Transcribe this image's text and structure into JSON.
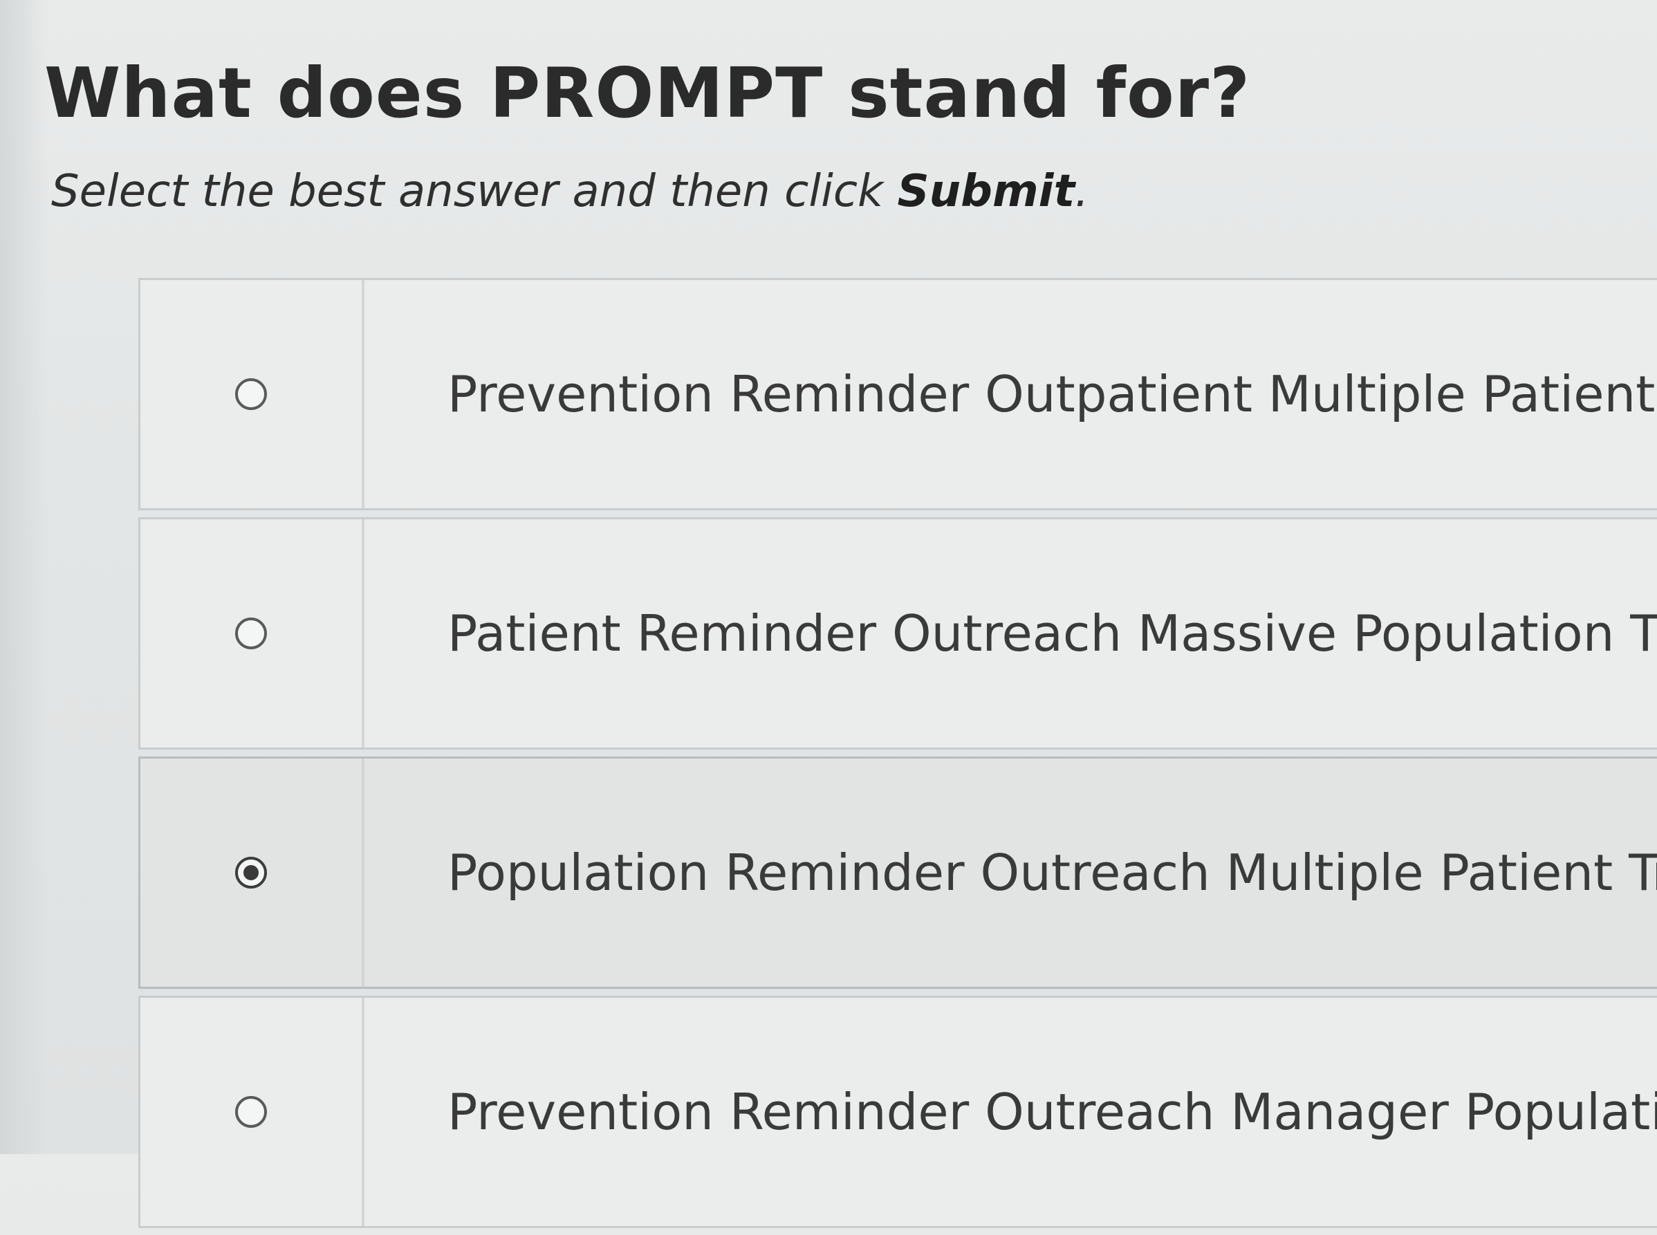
{
  "question": {
    "title": "What does PROMPT stand for?",
    "instruction_prefix": "Select the best answer and then click ",
    "instruction_bold": "Submit",
    "instruction_suffix": "."
  },
  "options": [
    {
      "label": "Prevention Reminder Outpatient Multiple Patient",
      "selected": false
    },
    {
      "label": "Patient Reminder Outreach Massive Population Tr",
      "selected": false
    },
    {
      "label": "Population Reminder Outreach Multiple Patient Tra",
      "selected": true
    },
    {
      "label": "Prevention Reminder Outreach Manager Populatio",
      "selected": false
    }
  ]
}
